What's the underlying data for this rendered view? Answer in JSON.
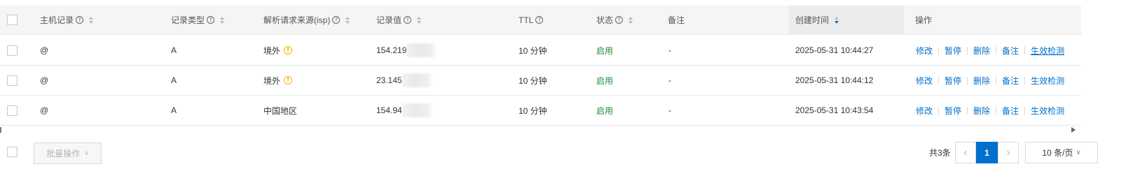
{
  "table": {
    "headers": {
      "host": "主机记录",
      "type": "记录类型",
      "isp": "解析请求来源(isp)",
      "value": "记录值",
      "ttl": "TTL",
      "status": "状态",
      "remark": "备注",
      "created": "创建时间",
      "actions": "操作"
    },
    "help_glyph": "?",
    "rows": [
      {
        "host": "@",
        "type": "A",
        "isp": "境外",
        "isp_warn": "!",
        "value": "154.219",
        "ttl": "10 分钟",
        "status": "启用",
        "remark": "-",
        "created": "2025-05-31 10:44:27"
      },
      {
        "host": "@",
        "type": "A",
        "isp": "境外",
        "isp_warn": "!",
        "value": "23.145",
        "ttl": "10 分钟",
        "status": "启用",
        "remark": "-",
        "created": "2025-05-31 10:44:12"
      },
      {
        "host": "@",
        "type": "A",
        "isp": "中国地区",
        "isp_warn": "",
        "value": "154.94",
        "ttl": "10 分钟",
        "status": "启用",
        "remark": "-",
        "created": "2025-05-31 10:43:54"
      }
    ],
    "row_actions": {
      "modify": "修改",
      "pause": "暂停",
      "delete": "删除",
      "remark": "备注",
      "check": "生效检测"
    }
  },
  "footer": {
    "batch_label": "批量操作",
    "batch_chevron": "∨",
    "total": "共3条",
    "prev": "‹",
    "current_page": "1",
    "next": "›",
    "page_size": "10 条/页",
    "page_size_chevron": "∨"
  },
  "colors": {
    "accent": "#0070cc",
    "status_on": "#1e8e3e",
    "warn": "#f0b400"
  }
}
